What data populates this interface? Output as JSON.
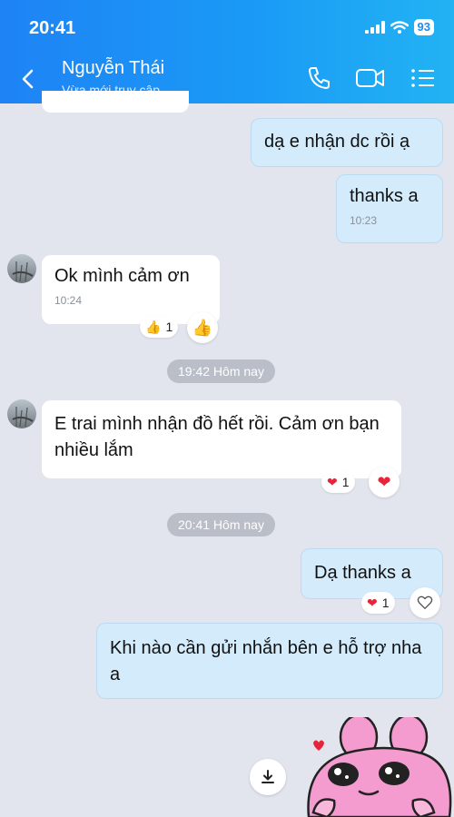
{
  "status_bar": {
    "time": "20:41",
    "battery": "93"
  },
  "header": {
    "name": "Nguyễn Thái",
    "status": "Vừa mới truy cập"
  },
  "messages": [
    {
      "text": "dạ e nhận dc rồi ạ"
    },
    {
      "text": "thanks a",
      "time": "10:23"
    },
    {
      "text": "Ok mình cảm ơn",
      "time": "10:24",
      "reaction_count": "1"
    },
    {
      "divider": "19:42 Hôm nay"
    },
    {
      "text": "E trai mình nhận đồ hết rồi. Cảm ơn bạn nhiều lắm",
      "reaction_count": "1"
    },
    {
      "divider": "20:41 Hôm nay"
    },
    {
      "text": "Dạ thanks a",
      "reaction_count": "1"
    },
    {
      "text": "Khi nào cần gửi nhắn bên e hỗ trợ nha a"
    }
  ],
  "colors": {
    "header_start": "#1e83f5",
    "header_end": "#22b3f3",
    "my_bubble": "#d3ebfb",
    "chat_bg": "#e2e5ee"
  },
  "icons": [
    "back-icon",
    "phone-icon",
    "video-call-icon",
    "menu-list-icon",
    "thumbs-up-icon",
    "heart-icon",
    "heart-outline-icon",
    "download-icon"
  ]
}
